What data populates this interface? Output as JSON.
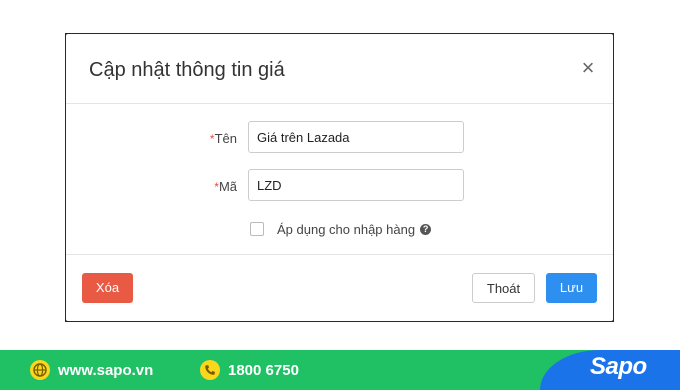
{
  "dialog": {
    "title": "Cập nhật thông tin giá",
    "close_glyph": "×"
  },
  "form": {
    "name": {
      "required_mark": "*",
      "label": "Tên",
      "value": "Giá trên Lazada"
    },
    "code": {
      "required_mark": "*",
      "label": "Mã",
      "value": "LZD"
    },
    "apply_checkbox": {
      "label": "Áp dụng cho nhập hàng",
      "checked": false,
      "help_glyph": "?"
    }
  },
  "footer": {
    "delete_label": "Xóa",
    "exit_label": "Thoát",
    "save_label": "Lưu"
  },
  "banner": {
    "website": "www.sapo.vn",
    "phone": "1800 6750",
    "brand": "Sapo"
  },
  "colors": {
    "delete": "#e95a45",
    "save": "#2d8ff0",
    "required": "#e74c3c",
    "banner_green": "#20c065",
    "banner_blue": "#1a73e8",
    "banner_icon": "#f9d71c"
  }
}
